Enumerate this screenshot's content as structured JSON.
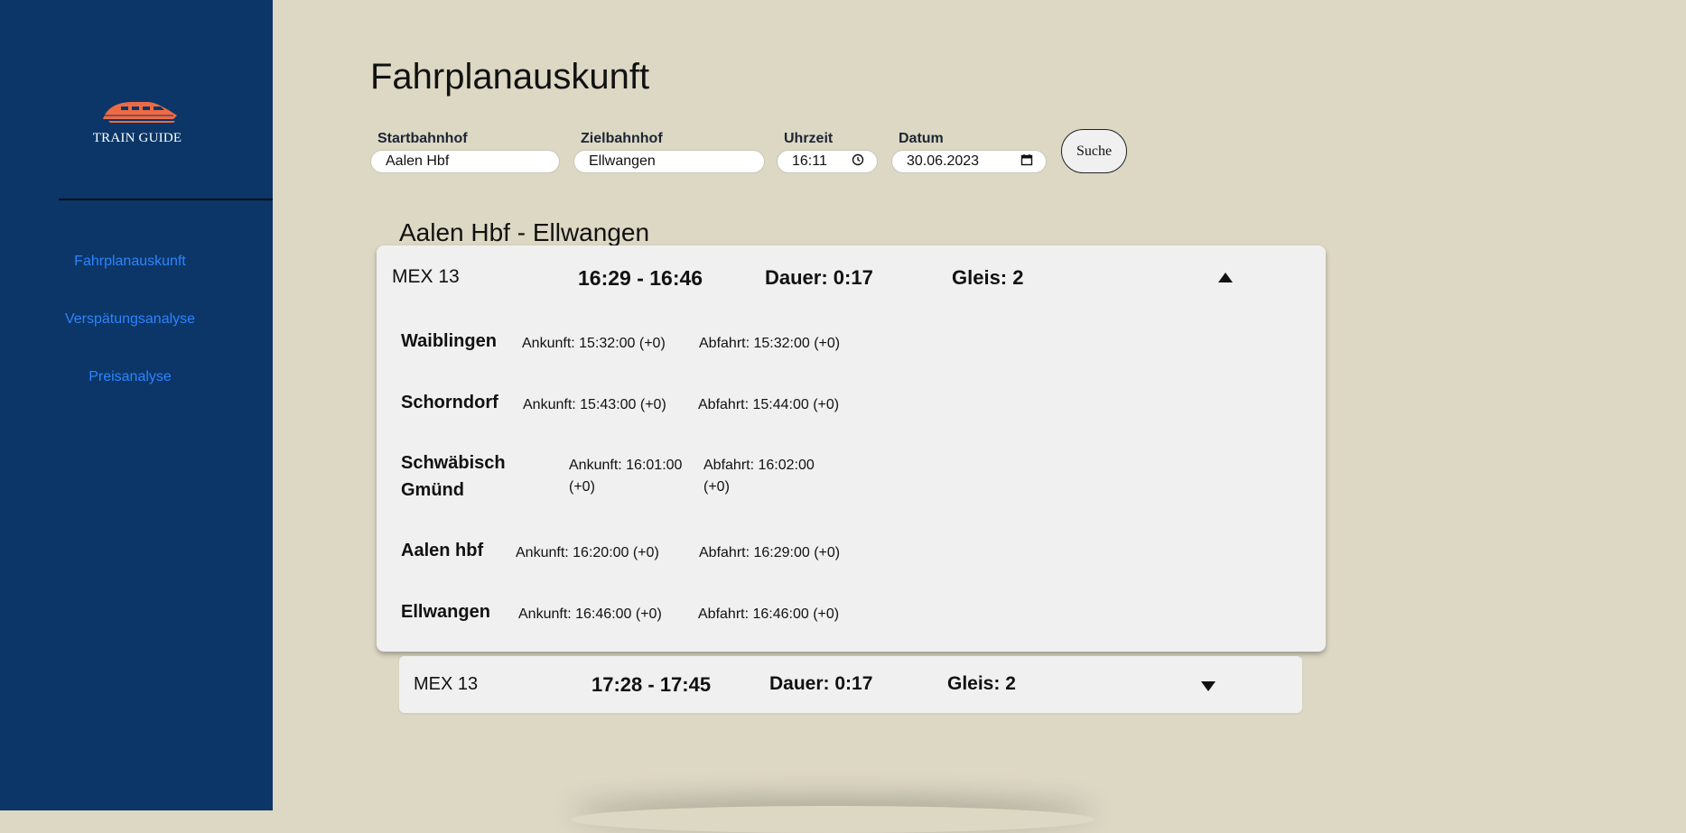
{
  "sidebar": {
    "logo_text": "TRAIN GUIDE",
    "items": [
      {
        "label": "Fahrplanauskunft"
      },
      {
        "label": "Verspätungsanalyse"
      },
      {
        "label": "Preisanalyse"
      }
    ]
  },
  "page_title": "Fahrplanauskunft",
  "form": {
    "start": {
      "label": "Startbahnhof",
      "value": "Aalen Hbf"
    },
    "ziel": {
      "label": "Zielbahnhof",
      "value": "Ellwangen"
    },
    "uhrzeit": {
      "label": "Uhrzeit",
      "value": "16:11",
      "icon": "clock-icon"
    },
    "datum": {
      "label": "Datum",
      "value": "30.06.2023",
      "icon": "calendar-icon"
    },
    "search_label": "Suche"
  },
  "route_title": "Aalen Hbf - Ellwangen",
  "connections": [
    {
      "line": "MEX 13",
      "time": "16:29 - 16:46",
      "duration": "Dauer: 0:17",
      "platform": "Gleis: 2",
      "expanded": true,
      "stops": [
        {
          "name": "Waiblingen",
          "arrival": "Ankunft: 15:32:00 (+0)",
          "departure": "Abfahrt: 15:32:00 (+0)"
        },
        {
          "name": "Schorndorf",
          "arrival": "Ankunft: 15:43:00 (+0)",
          "departure": "Abfahrt: 15:44:00 (+0)"
        },
        {
          "name": "Schwäbisch Gmünd",
          "arrival": "Ankunft: 16:01:00 (+0)",
          "departure": "Abfahrt: 16:02:00 (+0)"
        },
        {
          "name": "Aalen hbf",
          "arrival": "Ankunft: 16:20:00 (+0)",
          "departure": "Abfahrt: 16:29:00 (+0)"
        },
        {
          "name": "Ellwangen",
          "arrival": "Ankunft: 16:46:00 (+0)",
          "departure": "Abfahrt: 16:46:00 (+0)"
        }
      ]
    },
    {
      "line": "MEX 13",
      "time": "17:28 - 17:45",
      "duration": "Dauer: 0:17",
      "platform": "Gleis: 2",
      "expanded": false
    }
  ],
  "colors": {
    "sidebar_bg": "#0b3667",
    "page_bg": "#ddd8c4",
    "nav_link": "#2d84ff",
    "logo_accent": "#ee6a45",
    "card_bg": "#f0f0f0"
  }
}
